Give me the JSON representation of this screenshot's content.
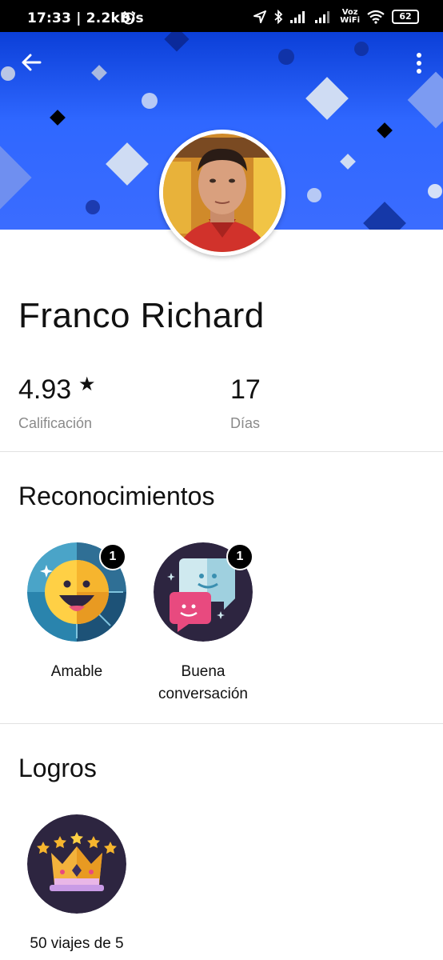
{
  "status_bar": {
    "time": "17:33 | 2.2kB/s",
    "voz_wifi_top": "Voz",
    "voz_wifi_bottom": "WiFi",
    "battery": "62"
  },
  "icons": {
    "back": "arrow-left-icon",
    "more": "more-vertical-icon",
    "star": "star-icon"
  },
  "profile": {
    "name": "Franco Richard",
    "rating": "4.93",
    "rating_symbol": "★",
    "rating_label": "Calificación",
    "days": "17",
    "days_label": "Días"
  },
  "recognitions": {
    "title": "Reconocimientos",
    "items": [
      {
        "label": "Amable",
        "count": "1"
      },
      {
        "label_line1": "Buena",
        "label_line2": "conversación",
        "count": "1"
      }
    ]
  },
  "achievements": {
    "title": "Logros",
    "items": [
      {
        "label": "50 viajes de 5"
      }
    ]
  },
  "colors": {
    "header_blue": "#2f67ff",
    "badge_dark": "#2d2540",
    "teal": "#1f6b8c",
    "smile_yellow": "#ffd045",
    "bubble_pink": "#e84a7f",
    "bubble_light": "#cfe9ef"
  }
}
